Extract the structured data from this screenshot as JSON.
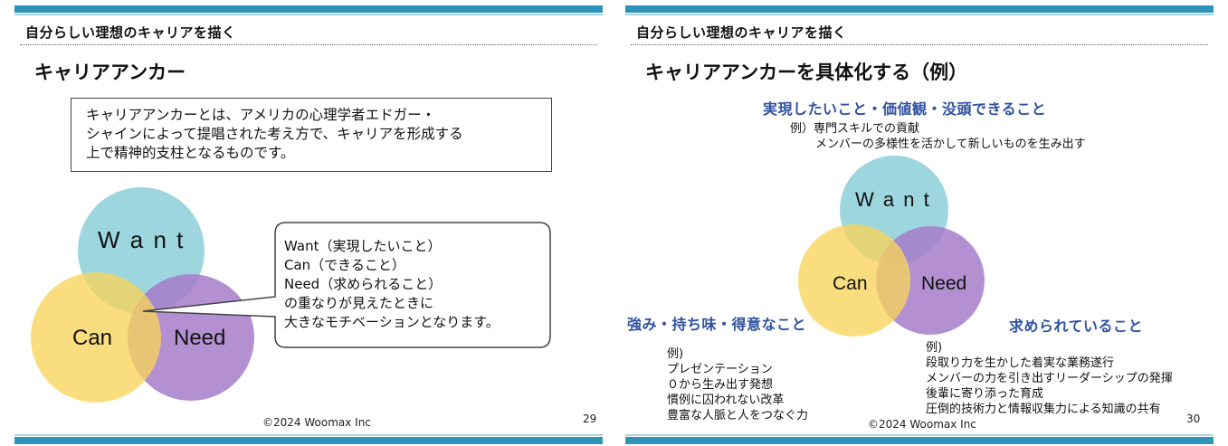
{
  "slides": [
    {
      "section_title": "自分らしい理想のキャリアを描く",
      "title": "キャリアアンカー",
      "definition_lines": [
        "キャリアアンカーとは、アメリカの心理学者エドガー・",
        "シャインによって提唱された考え方で、キャリアを形成する",
        "上で精神的支柱となるものです。"
      ],
      "venn": {
        "want": "W a n t",
        "can": "Can",
        "need": "Need"
      },
      "callout_lines": [
        "Want（実現したいこと）",
        "Can（できること）",
        "Need（求められること）",
        "の重なりが見えたときに",
        "大きなモチベーションとなります。"
      ],
      "copyright": "©2024 Woomax Inc",
      "page_number": "29"
    },
    {
      "section_title": "自分らしい理想のキャリアを描く",
      "title": "キャリアアンカーを具体化する（例）",
      "want_heading": "実現したいこと・価値観・没頭できること",
      "want_examples": [
        "例）専門スキルでの貢献",
        "メンバーの多様性を活かして新しいものを生み出す"
      ],
      "venn": {
        "want": "W a n t",
        "can": "Can",
        "need": "Need"
      },
      "can_heading": "強み・持ち味・得意なこと",
      "can_examples": [
        "例)",
        "プレゼンテーション",
        "０から生み出す発想",
        "慣例に囚われない改革",
        "豊富な人脈と人をつなぐ力"
      ],
      "need_heading": "求められていること",
      "need_examples": [
        "例)",
        "段取り力を生かした着実な業務遂行",
        "メンバーの力を引き出すリーダーシップの発揮",
        "後輩に寄り添った育成",
        "圧倒的技術力と情報収集力による知識の共有"
      ],
      "copyright": "©2024 Woomax Inc",
      "page_number": "30"
    }
  ],
  "colors": {
    "accent_bar": "#2e93b8",
    "want_circle": "#8ccfd8",
    "can_circle": "#f7d35a",
    "need_circle": "#a67cc9",
    "heading_blue": "#2f52a0"
  }
}
